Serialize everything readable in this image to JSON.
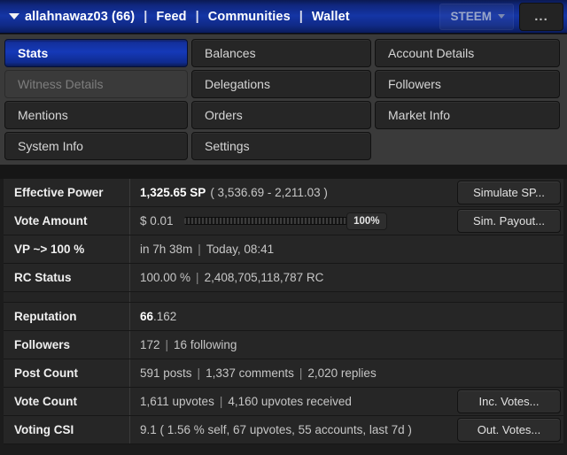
{
  "header": {
    "caret_icon": "chevron-down-icon",
    "account": "allahnawaz03 (66)",
    "nav": [
      "Feed",
      "Communities",
      "Wallet"
    ],
    "separator": "|",
    "currency": "STEEM",
    "currency_caret_icon": "chevron-down-icon",
    "overflow_label": "...",
    "bg_color": "#1435a5"
  },
  "tabs": {
    "column1": [
      {
        "label": "Stats",
        "state": "active"
      },
      {
        "label": "Witness Details",
        "state": "disabled"
      },
      {
        "label": "Mentions",
        "state": "normal"
      },
      {
        "label": "System Info",
        "state": "normal"
      }
    ],
    "column2": [
      {
        "label": "Balances",
        "state": "normal"
      },
      {
        "label": "Delegations",
        "state": "normal"
      },
      {
        "label": "Orders",
        "state": "normal"
      },
      {
        "label": "Settings",
        "state": "normal"
      }
    ],
    "column3": [
      {
        "label": "Account Details",
        "state": "normal"
      },
      {
        "label": "Followers",
        "state": "normal"
      },
      {
        "label": "Market Info",
        "state": "normal"
      },
      {
        "label": "",
        "state": "empty"
      }
    ],
    "active_color": "#1539b8"
  },
  "stats": {
    "effective_power": {
      "label": "Effective Power",
      "value_main": "1,325.65 SP",
      "value_range": "( 3,536.69 - 2,211.03 )",
      "button": "Simulate SP..."
    },
    "vote_amount": {
      "label": "Vote Amount",
      "value": "$ 0.01",
      "percent": "100%",
      "percent_value": 100,
      "button": "Sim. Payout..."
    },
    "vp_to_100": {
      "label": "VP ~> 100 %",
      "time_remaining": "in 7h 38m",
      "eta": "Today, 08:41"
    },
    "rc_status": {
      "label": "RC Status",
      "percent": "100.00 %",
      "rc": "2,408,705,118,787 RC"
    },
    "reputation": {
      "label": "Reputation",
      "value_int": "66",
      "value_frac": ".162"
    },
    "followers": {
      "label": "Followers",
      "count": "172",
      "following": "16 following"
    },
    "post_count": {
      "label": "Post Count",
      "posts": "591 posts",
      "comments": "1,337 comments",
      "replies": "2,020 replies"
    },
    "vote_count": {
      "label": "Vote Count",
      "upvotes": "1,611 upvotes",
      "received": "4,160 upvotes received",
      "button": "Inc. Votes..."
    },
    "voting_csi": {
      "label": "Voting CSI",
      "value": "9.1 ( 1.56 % self, 67 upvotes, 55 accounts, last 7d )",
      "button": "Out. Votes..."
    }
  }
}
